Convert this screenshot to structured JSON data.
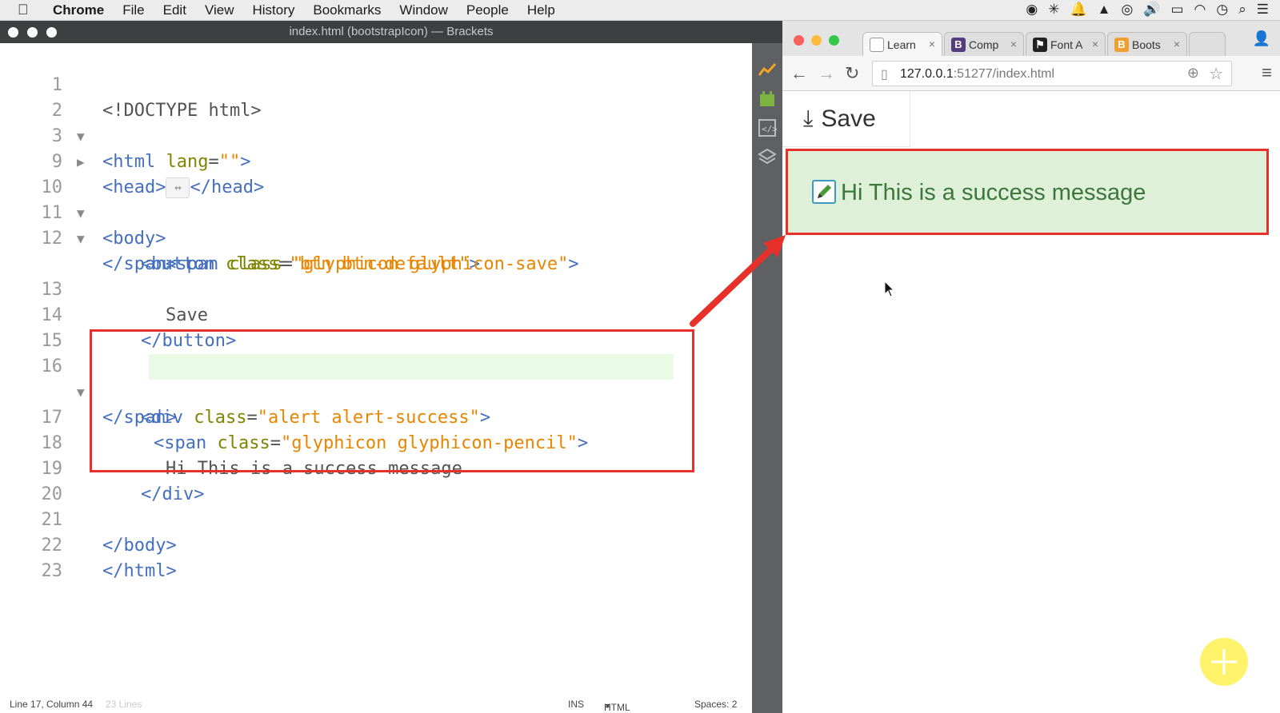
{
  "menubar": {
    "app": "Chrome",
    "items": [
      "File",
      "Edit",
      "View",
      "History",
      "Bookmarks",
      "Window",
      "People",
      "Help"
    ]
  },
  "brackets": {
    "title": "index.html (bootstrapIcon) — Brackets",
    "lines": [
      {
        "num": "1"
      },
      {
        "num": "2"
      },
      {
        "num": "3"
      },
      {
        "num": "9"
      },
      {
        "num": "10"
      },
      {
        "num": "11"
      },
      {
        "num": "12"
      },
      {
        "num": "13"
      },
      {
        "num": "14"
      },
      {
        "num": "15"
      },
      {
        "num": "16"
      },
      {
        "num": "17"
      },
      {
        "num": "18"
      },
      {
        "num": "19"
      },
      {
        "num": "20"
      },
      {
        "num": "21"
      },
      {
        "num": "22"
      },
      {
        "num": "23"
      }
    ],
    "code": {
      "doctype": "<!DOCTYPE html>",
      "html_open": "<html",
      "lang_attr": "lang",
      "eq": "=",
      "lang_val": "\"\"",
      "gt": ">",
      "head_open": "<head>",
      "collapsed_glyph": "↔",
      "head_close": "</head>",
      "body_open": "<body>",
      "button_open": "<button",
      "class_attr": "class",
      "btn_class_val": "\"btn btn-default\"",
      "span_open": "<span",
      "save_span_val": "\"glyphicon glyphicon-save\"",
      "span_close": "</span>",
      "save_text": "Save",
      "button_close": "</button>",
      "div_open": "<div",
      "alert_val": "\"alert alert-success\"",
      "pencil_val": "\"glyphicon glyphicon-pencil\"",
      "success_text": "Hi This is a success message",
      "div_close": "</div>",
      "body_close": "</body>",
      "html_close": "</html>"
    },
    "status": {
      "position": "Line 17, Column 44",
      "lines": "23 Lines",
      "mode": "INS",
      "language": "HTML",
      "spaces": "Spaces: 2"
    }
  },
  "chrome": {
    "tabs": [
      {
        "label": "Learn",
        "icon": "page-icon",
        "color": "#ffffff"
      },
      {
        "label": "Comp",
        "icon": "B",
        "color": "#563d7c"
      },
      {
        "label": "Font A",
        "icon": "flag",
        "color": "#222222"
      },
      {
        "label": "Boots",
        "icon": "B",
        "color": "#f0a030"
      }
    ],
    "url_host": "127.0.0.1",
    "url_rest": ":51277/index.html",
    "page": {
      "save_label": "Save",
      "alert_text": "Hi This is a success message"
    }
  },
  "colors": {
    "alert_bg": "#dff0d8",
    "alert_text": "#3c763d",
    "annotation_red": "#e8302a"
  }
}
